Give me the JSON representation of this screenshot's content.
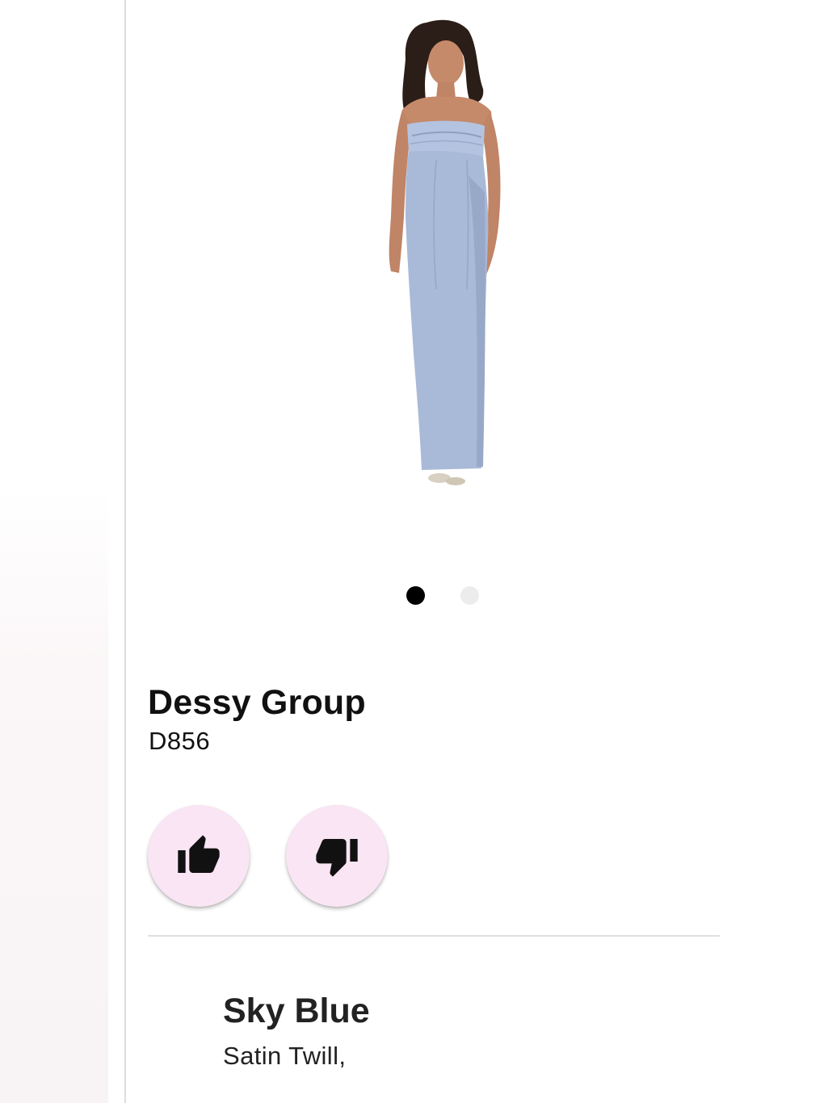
{
  "product": {
    "brand": "Dessy Group",
    "style_code": "D856",
    "image_alt": "dress-photo",
    "dress_color_hex": "#a9b9d8"
  },
  "carousel": {
    "total": 2,
    "active_index": 1
  },
  "actions": {
    "like_icon": "thumbs-up-icon",
    "dislike_icon": "thumbs-down-icon",
    "button_color": "#f9e5f3"
  },
  "color_option": {
    "name": "Sky Blue",
    "fabric": "Satin Twill,"
  }
}
